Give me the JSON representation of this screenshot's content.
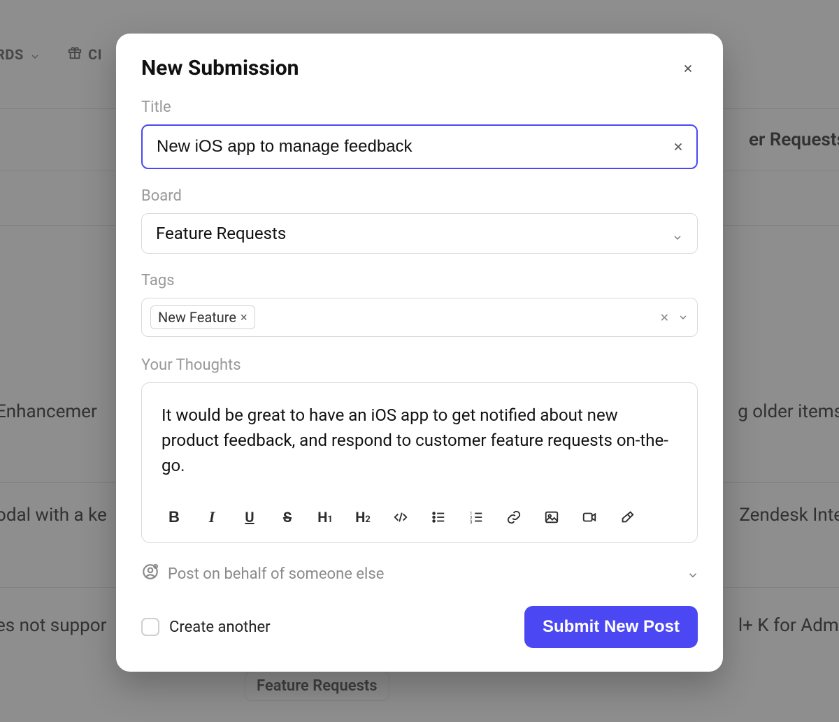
{
  "background": {
    "nav_item_boards": "RDS",
    "nav_item_changelog_initial": "CI",
    "tab_right": "er Requests",
    "cells": {
      "enhancement": "Enhancemer",
      "older_items": "g older items",
      "modal_key": "odal with a ke",
      "zendesk": "Zendesk Inte",
      "not_support": "es not suppor",
      "cmdk": "l+ K for Admi"
    },
    "bottom_badge": "Feature Requests"
  },
  "modal": {
    "title": "New Submission",
    "labels": {
      "title": "Title",
      "board": "Board",
      "tags": "Tags",
      "thoughts": "Your Thoughts"
    },
    "fields": {
      "title_value": "New iOS app to manage feedback",
      "board_value": "Feature Requests",
      "tags": [
        "New Feature"
      ],
      "thoughts_value": "It would be great to have an iOS app to get notified about new product feedback, and respond to customer feature requests on-the-go."
    },
    "post_on_behalf_label": "Post on behalf of someone else",
    "create_another_label": "Create another",
    "submit_label": "Submit New Post"
  }
}
